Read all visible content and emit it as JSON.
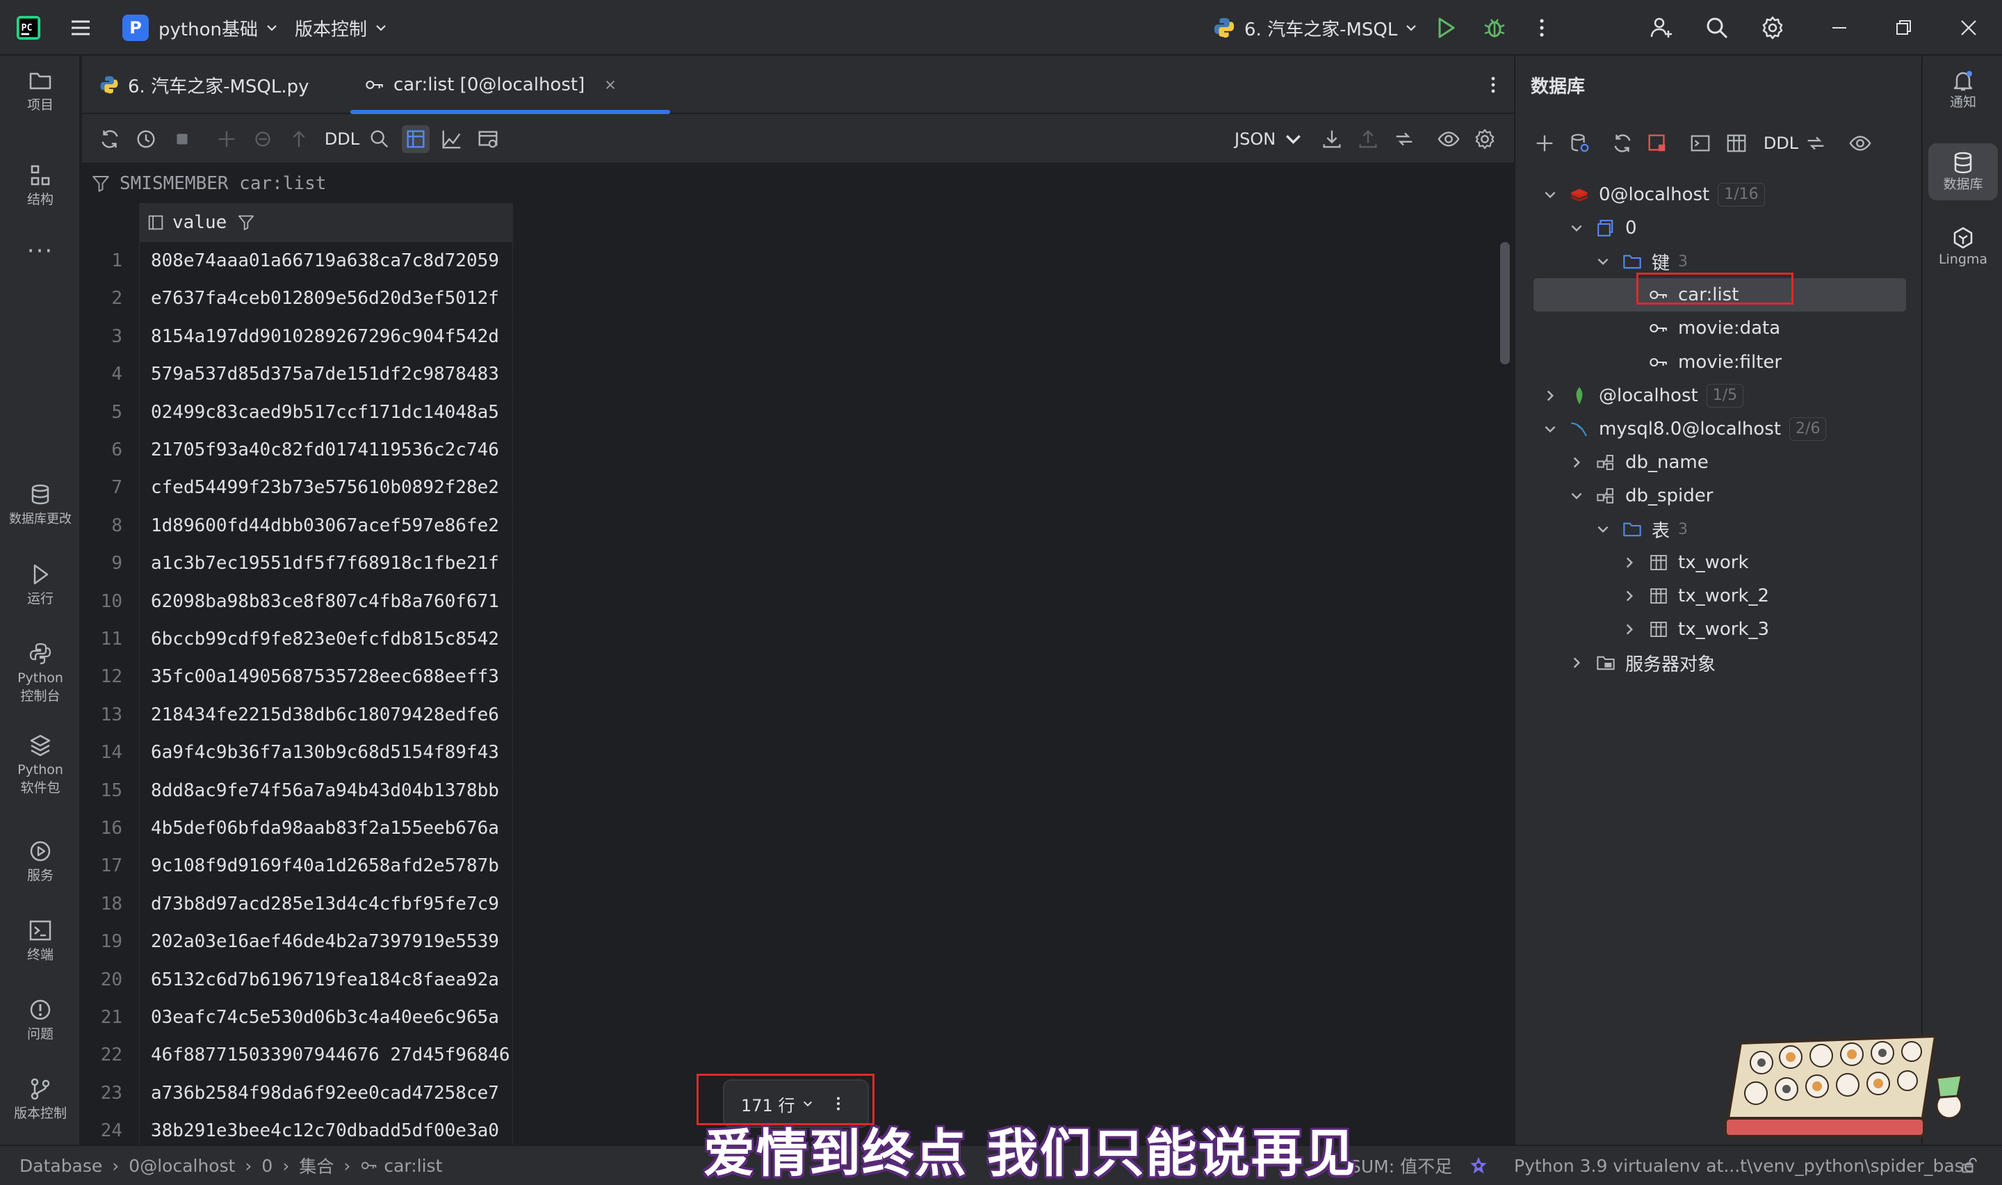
{
  "titlebar": {
    "project_initial": "P",
    "project_name": "python基础",
    "vcs": "版本控制",
    "run_config": "6. 汽车之家-MSQL"
  },
  "left_strip": {
    "items": [
      {
        "label": "项目",
        "icon": "folder-icon"
      },
      {
        "label": "结构",
        "icon": "structure-icon"
      },
      {
        "label": "数据库更改",
        "icon": "db-changes-icon"
      },
      {
        "label": "运行",
        "icon": "run-icon"
      },
      {
        "label": "Python\n控制台",
        "icon": "python-console-icon"
      },
      {
        "label": "Python\n软件包",
        "icon": "python-packages-icon"
      },
      {
        "label": "服务",
        "icon": "services-icon"
      },
      {
        "label": "终端",
        "icon": "terminal-icon"
      },
      {
        "label": "问题",
        "icon": "problems-icon"
      },
      {
        "label": "版本控制",
        "icon": "vcs-icon"
      }
    ],
    "more": "···"
  },
  "right_strip": {
    "items": [
      {
        "label": "通知",
        "icon": "bell-icon"
      },
      {
        "label": "数据库",
        "icon": "database-icon"
      },
      {
        "label": "Lingma",
        "icon": "lingma-icon"
      }
    ]
  },
  "tabs": [
    {
      "label": "6. 汽车之家-MSQL.py",
      "active": false
    },
    {
      "label": "car:list [0@localhost]",
      "active": true
    }
  ],
  "toolbar": {
    "ddl": "DDL",
    "format": "JSON"
  },
  "filter": {
    "query": "SMISMEMBER car:list"
  },
  "grid": {
    "column": "value",
    "rows": [
      "808e74aaa01a66719a638ca7c8d72059",
      "e7637fa4ceb012809e56d20d3ef5012f",
      "8154a197dd9010289267296c904f542d",
      "579a537d85d375a7de151df2c9878483",
      "02499c83caed9b517ccf171dc14048a5",
      "21705f93a40c82fd0174119536c2c746",
      "cfed54499f23b73e575610b0892f28e2",
      "1d89600fd44dbb03067acef597e86fe2",
      "a1c3b7ec19551df5f7f68918c1fbe21f",
      "62098ba98b83ce8f807c4fb8a760f671",
      "6bccb99cdf9fe823e0efcfdb815c8542",
      "35fc00a14905687535728eec688eeff3",
      "218434fe2215d38db6c18079428edfe6",
      "6a9f4c9b36f7a130b9c68d5154f89f43",
      "8dd8ac9fe74f56a7a94b43d04b1378bb",
      "4b5def06bfda98aab83f2a155eeb676a",
      "9c108f9d9169f40a1d2658afd2e5787b",
      "d73b8d97acd285e13d4c4cfbf95fe7c9",
      "202a03e16aef46de4b2a7397919e5539",
      "65132c6d7b6196719fea184c8faea92a",
      "03eafc74c5e530d06b3c4a40ee6c965a",
      "46f887715033907944676 27d45f96846",
      "a736b2584f98da6f92ee0cad47258ce7",
      "38b291e3bee4c12c70dbadd5df00e3a0"
    ]
  },
  "row_count": {
    "label": "171 行"
  },
  "db_panel": {
    "title": "数据库",
    "ddl": "DDL",
    "tree": [
      {
        "label": "0@localhost",
        "count": "1/16",
        "icon": "redis-icon",
        "expanded": true
      },
      {
        "label": "0",
        "icon": "schema-icon",
        "expanded": true
      },
      {
        "label": "键",
        "count": "3",
        "icon": "folder-icon",
        "expanded": true
      },
      {
        "label": "car:list",
        "icon": "key-icon",
        "selected": true
      },
      {
        "label": "movie:data",
        "icon": "key-icon"
      },
      {
        "label": "movie:filter",
        "icon": "key-icon"
      },
      {
        "label": "@localhost",
        "count": "1/5",
        "icon": "mongodb-icon",
        "expanded": false
      },
      {
        "label": "mysql8.0@localhost",
        "count": "2/6",
        "icon": "mysql-icon",
        "expanded": true
      },
      {
        "label": "db_name",
        "icon": "database-schema-icon",
        "expanded": false
      },
      {
        "label": "db_spider",
        "icon": "database-schema-icon",
        "expanded": true
      },
      {
        "label": "表",
        "count": "3",
        "icon": "folder-icon",
        "expanded": true
      },
      {
        "label": "tx_work",
        "icon": "table-icon",
        "expanded": false
      },
      {
        "label": "tx_work_2",
        "icon": "table-icon",
        "expanded": false
      },
      {
        "label": "tx_work_3",
        "icon": "table-icon",
        "expanded": false
      },
      {
        "label": "服务器对象",
        "icon": "server-objects-icon",
        "expanded": false
      }
    ]
  },
  "statusbar": {
    "breadcrumb": [
      "Database",
      "0@localhost",
      "0",
      "集合",
      "car:list"
    ],
    "sum": "SUM: 值不足",
    "interpreter": "Python 3.9 virtualenv at...t\\venv_python\\spider_base"
  },
  "subtitle": "爱情到终点 我们只能说再见",
  "colors": {
    "accent": "#3574f0",
    "highlight_box": "#e0282b",
    "run_green": "#5fb865"
  }
}
